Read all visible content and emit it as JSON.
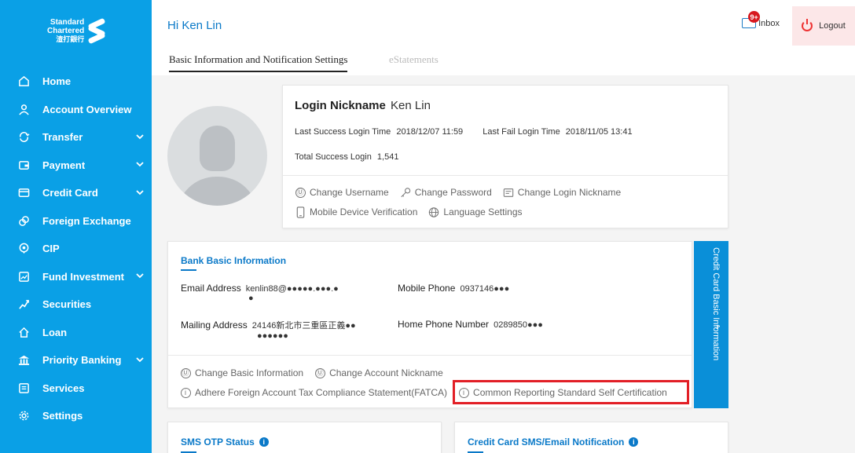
{
  "brand": {
    "name_line1": "Standard",
    "name_line2": "Chartered",
    "name_cn": "渣打銀行"
  },
  "sidebar": {
    "items": [
      {
        "label": "Home",
        "icon": "home-icon",
        "expandable": false
      },
      {
        "label": "Account Overview",
        "icon": "person-icon",
        "expandable": false
      },
      {
        "label": "Transfer",
        "icon": "transfer-icon",
        "expandable": true
      },
      {
        "label": "Payment",
        "icon": "wallet-icon",
        "expandable": true
      },
      {
        "label": "Credit Card",
        "icon": "credit-card-icon",
        "expandable": true
      },
      {
        "label": "Foreign Exchange",
        "icon": "exchange-icon",
        "expandable": false
      },
      {
        "label": "CIP",
        "icon": "cip-icon",
        "expandable": false
      },
      {
        "label": "Fund Investment",
        "icon": "chart-icon",
        "expandable": true
      },
      {
        "label": "Securities",
        "icon": "securities-icon",
        "expandable": false
      },
      {
        "label": "Loan",
        "icon": "house-icon",
        "expandable": false
      },
      {
        "label": "Priority Banking",
        "icon": "bank-icon",
        "expandable": true
      },
      {
        "label": "Services",
        "icon": "services-icon",
        "expandable": false
      },
      {
        "label": "Settings",
        "icon": "gear-icon",
        "expandable": false
      }
    ],
    "chevron": "⌄"
  },
  "header": {
    "greeting": "Hi Ken Lin",
    "inbox_label": "Inbox",
    "inbox_badge": "9+",
    "logout_label": "Logout"
  },
  "tabs": {
    "active": "Basic Information and Notification Settings",
    "inactive": "eStatements"
  },
  "profile": {
    "nickname_label": "Login Nickname",
    "nickname_value": "Ken Lin",
    "last_success_label": "Last Success Login Time",
    "last_success_value": "2018/12/07 11:59",
    "last_fail_label": "Last Fail Login Time",
    "last_fail_value": "2018/11/05 13:41",
    "total_label": "Total Success Login",
    "total_value": "1,541",
    "actions": {
      "change_username": "Change Username",
      "change_password": "Change Password",
      "change_nickname": "Change Login Nickname",
      "mobile_verification": "Mobile Device Verification",
      "language_settings": "Language Settings"
    }
  },
  "bank_info": {
    "title": "Bank Basic Information",
    "email_label": "Email Address",
    "email_value_1": "kenlin88@●●●●●.●●●.●",
    "email_value_2": "●",
    "mobile_label": "Mobile Phone",
    "mobile_value": "0937146●●●",
    "mailing_label": "Mailing Address",
    "mailing_value_1": "24146新北市三重區正義●●",
    "mailing_value_2": "●●●●●●",
    "home_phone_label": "Home Phone Number",
    "home_phone_value": "0289850●●●",
    "actions": {
      "change_basic": "Change Basic Information",
      "change_account_nickname": "Change Account Nickname",
      "fatca": "Adhere Foreign Account Tax Compliance Statement(FATCA)",
      "crs": "Common Reporting Standard Self Certification"
    }
  },
  "credit_card_side": {
    "label": "Credit Card Basic Information",
    "chevron": "›"
  },
  "sms": {
    "title": "SMS OTP Status",
    "info": "i"
  },
  "cc_notify": {
    "title": "Credit Card SMS/Email Notification",
    "info": "i"
  },
  "colors": {
    "sidebar": "#0aa0e6",
    "accent": "#0a79c8",
    "highlight": "#e21f26"
  }
}
